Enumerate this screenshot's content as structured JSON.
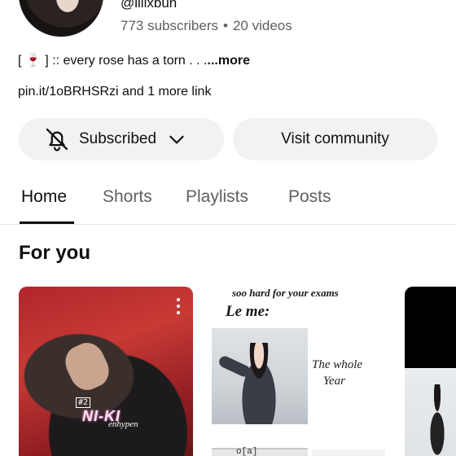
{
  "channel": {
    "handle": "@lilixbun",
    "subscribers": "773 subscribers",
    "separator": "•",
    "videos": "20 videos",
    "description": {
      "open_bracket": "[",
      "emoji": "🍷",
      "close_bracket": "]",
      "text": ":: every rose has a torn . . .",
      "more": "...more"
    },
    "links": "pin.it/1oBRHSRzi and 1 more link"
  },
  "actions": {
    "subscribed_label": "Subscribed",
    "visit_community_label": "Visit community"
  },
  "tabs": [
    {
      "label": "Home",
      "active": true
    },
    {
      "label": "Shorts",
      "active": false
    },
    {
      "label": "Playlists",
      "active": false
    },
    {
      "label": "Posts",
      "active": false
    }
  ],
  "section": {
    "title": "For you"
  },
  "shorts": [
    {
      "overlay_number": "#2",
      "overlay_title": "NI-KI",
      "overlay_group": "enhypen"
    },
    {
      "caption_top": "soo hard for your exams",
      "caption_me": "Le me:",
      "caption_side_1": "The whole",
      "caption_side_2": "Year",
      "strip_text": "o[a]"
    }
  ],
  "colors": {
    "accent_text": "#0f0f0f",
    "secondary_text": "#606060",
    "button_bg": "#f2f2f2"
  }
}
